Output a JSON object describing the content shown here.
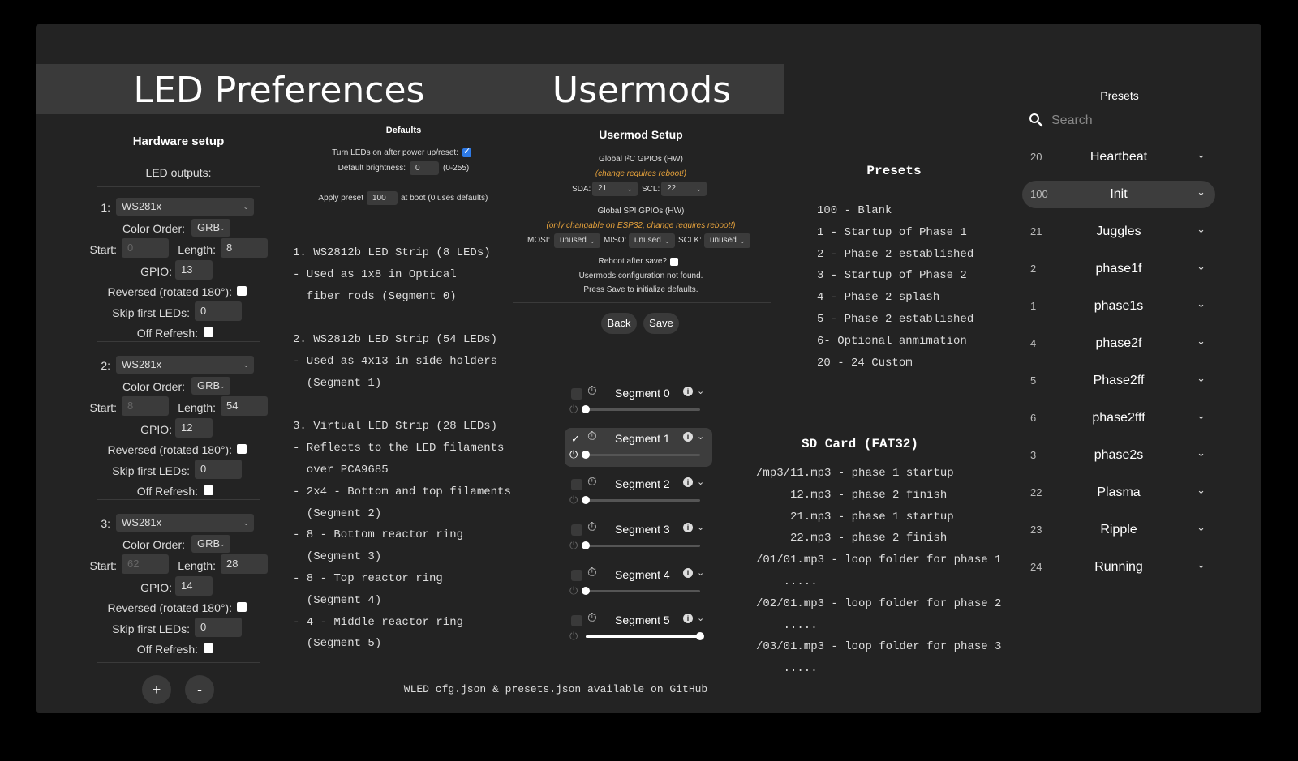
{
  "led": {
    "title": "LED Preferences",
    "hardware_title": "Hardware setup",
    "outputs_label": "LED outputs:",
    "labels": {
      "color_order": "Color Order:",
      "start": "Start:",
      "length": "Length:",
      "gpio": "GPIO:",
      "reversed": "Reversed (rotated 180°):",
      "skip": "Skip first LEDs:",
      "off_refresh": "Off Refresh:"
    },
    "outputs": [
      {
        "index": "1:",
        "type": "WS281x",
        "color_order": "GRB",
        "start": "0",
        "length": "8",
        "gpio": "13",
        "skip": "0"
      },
      {
        "index": "2:",
        "type": "WS281x",
        "color_order": "GRB",
        "start": "8",
        "length": "54",
        "gpio": "12",
        "skip": "0"
      },
      {
        "index": "3:",
        "type": "WS281x",
        "color_order": "GRB",
        "start": "62",
        "length": "28",
        "gpio": "14",
        "skip": "0"
      }
    ],
    "add_label": "+",
    "remove_label": "-"
  },
  "defaults": {
    "title": "Defaults",
    "turn_on_label": "Turn LEDs on after power up/reset:",
    "turn_on_checked": true,
    "brightness_label": "Default brightness:",
    "brightness_value": "0",
    "brightness_range": "(0-255)",
    "apply_label": "Apply preset",
    "apply_value": "100",
    "apply_suffix": "at boot (0 uses defaults)"
  },
  "notes": [
    "1. WS2812b LED Strip (8 LEDs)",
    "- Used as 1x8 in Optical",
    "  fiber rods (Segment 0)",
    "",
    "2. WS2812b LED Strip (54 LEDs)",
    "- Used as 4x13 in side holders",
    "  (Segment 1)",
    "",
    "3. Virtual LED Strip (28 LEDs)",
    "- Reflects to the LED filaments",
    "  over PCA9685",
    "- 2x4 - Bottom and top filaments",
    "  (Segment 2)",
    "- 8 - Bottom reactor ring",
    "  (Segment 3)",
    "- 8 - Top reactor ring",
    "  (Segment 4)",
    "- 4 - Middle reactor ring",
    "  (Segment 5)"
  ],
  "usermods": {
    "title": "Usermods",
    "setup_title": "Usermod Setup",
    "i2c_label": "Global I²C GPIOs (HW)",
    "i2c_note": "(change requires reboot!)",
    "sda_label": "SDA:",
    "sda_value": "21",
    "scl_label": "SCL:",
    "scl_value": "22",
    "spi_label": "Global SPI GPIOs (HW)",
    "spi_note": "(only changable on ESP32, change requires reboot!)",
    "mosi_label": "MOSI:",
    "mosi_value": "unused",
    "miso_label": "MISO:",
    "miso_value": "unused",
    "sclk_label": "SCLK:",
    "sclk_value": "unused",
    "reboot_label": "Reboot after save?",
    "not_found": "Usermods configuration not found.",
    "press_save": "Press Save to initialize defaults.",
    "back_label": "Back",
    "save_label": "Save"
  },
  "segments": [
    {
      "name": "Segment 0",
      "checked": false,
      "level": 0.0
    },
    {
      "name": "Segment 1",
      "checked": true,
      "level": 0.0
    },
    {
      "name": "Segment 2",
      "checked": false,
      "level": 0.0
    },
    {
      "name": "Segment 3",
      "checked": false,
      "level": 0.0
    },
    {
      "name": "Segment 4",
      "checked": false,
      "level": 0.0
    },
    {
      "name": "Segment 5",
      "checked": false,
      "level": 1.0
    }
  ],
  "presets_note": {
    "title": "Presets",
    "lines": [
      "100 - Blank",
      "1 - Startup of Phase 1",
      "2 - Phase 2 established",
      "3 - Startup of Phase 2",
      "4 - Phase 2 splash",
      "5 - Phase 2 established",
      "6- Optional anmimation",
      "20 - 24 Custom"
    ]
  },
  "sdcard": {
    "title": "SD Card (FAT32)",
    "lines": [
      "/mp3/11.mp3 - phase 1 startup",
      "     12.mp3 - phase 2 finish",
      "     21.mp3 - phase 1 startup",
      "     22.mp3 - phase 2 finish",
      "/01/01.mp3 - loop folder for phase 1",
      "    .....",
      "/02/01.mp3 - loop folder for phase 2",
      "    .....",
      "/03/01.mp3 - loop folder for phase 3",
      "    ....."
    ]
  },
  "footer": "WLED cfg.json & presets.json available on GitHub",
  "presets": {
    "title": "Presets",
    "search_placeholder": "Search",
    "items": [
      {
        "id": "20",
        "name": "Heartbeat",
        "active": false
      },
      {
        "id": "100",
        "name": "Init",
        "active": true
      },
      {
        "id": "21",
        "name": "Juggles",
        "active": false
      },
      {
        "id": "2",
        "name": "phase1f",
        "active": false
      },
      {
        "id": "1",
        "name": "phase1s",
        "active": false
      },
      {
        "id": "4",
        "name": "phase2f",
        "active": false
      },
      {
        "id": "5",
        "name": "Phase2ff",
        "active": false
      },
      {
        "id": "6",
        "name": "phase2fff",
        "active": false
      },
      {
        "id": "3",
        "name": "phase2s",
        "active": false
      },
      {
        "id": "22",
        "name": "Plasma",
        "active": false
      },
      {
        "id": "23",
        "name": "Ripple",
        "active": false
      },
      {
        "id": "24",
        "name": "Running",
        "active": false
      }
    ]
  },
  "colors": {
    "background": "#232323",
    "title_bar": "#3a3a3a",
    "warning": "#e6a23c",
    "accent": "#2e7ae6"
  }
}
